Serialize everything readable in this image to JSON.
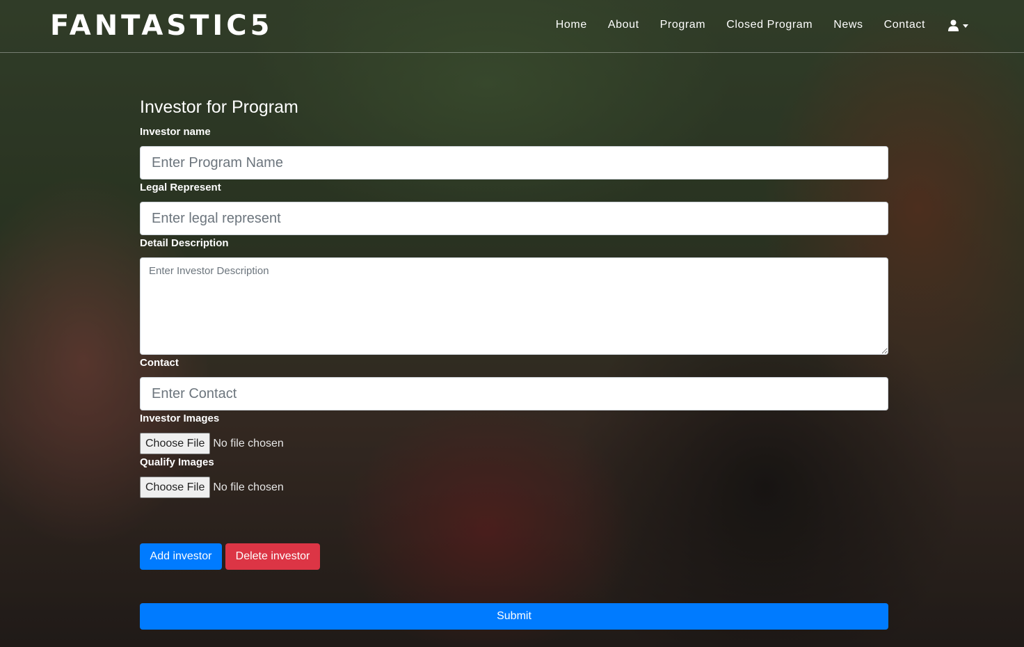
{
  "brand": "FANTASTIC5",
  "nav": {
    "items": [
      "Home",
      "About",
      "Program",
      "Closed Program",
      "News",
      "Contact"
    ]
  },
  "form": {
    "title": "Investor for Program",
    "investor_name": {
      "label": "Investor name",
      "placeholder": "Enter Program Name"
    },
    "legal_represent": {
      "label": "Legal Represent",
      "placeholder": "Enter legal represent"
    },
    "detail_description": {
      "label": "Detail Description",
      "placeholder": "Enter Investor Description"
    },
    "contact": {
      "label": "Contact",
      "placeholder": "Enter Contact"
    },
    "investor_images": {
      "label": "Investor Images",
      "button": "Choose File",
      "status": "No file chosen"
    },
    "qualify_images": {
      "label": "Qualify Images",
      "button": "Choose File",
      "status": "No file chosen"
    },
    "add_investor": "Add investor",
    "delete_investor": "Delete investor",
    "submit": "Submit"
  },
  "colors": {
    "primary": "#007bff",
    "danger": "#dc3545"
  },
  "icons": {
    "user": "user-icon",
    "caret": "caret-down-icon"
  }
}
